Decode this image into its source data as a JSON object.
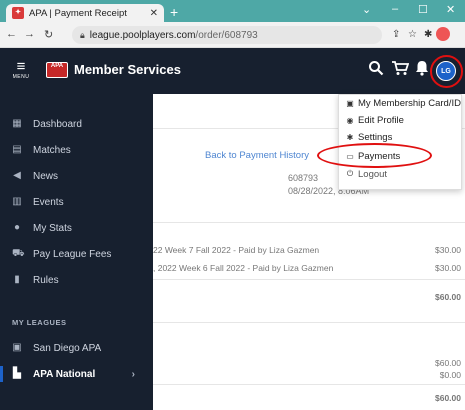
{
  "browser": {
    "tab_title": "APA | Payment Receipt",
    "tab_close": "✕",
    "new_tab": "+",
    "url_host": "league.poolplayers.com",
    "url_path": "/order/608793",
    "window_controls": [
      "⌄",
      "–",
      "☐",
      "✕"
    ]
  },
  "header": {
    "menu_label": "MENU",
    "logo_text": "APA",
    "title": "Member Services",
    "avatar_initials": "LG"
  },
  "sidebar": {
    "items": [
      {
        "label": "Dashboard",
        "icon": "dashboard-icon"
      },
      {
        "label": "Matches",
        "icon": "matches-icon"
      },
      {
        "label": "News",
        "icon": "megaphone-icon"
      },
      {
        "label": "Events",
        "icon": "calendar-icon"
      },
      {
        "label": "My Stats",
        "icon": "person-icon"
      },
      {
        "label": "Pay League Fees",
        "icon": "cart-icon"
      },
      {
        "label": "Rules",
        "icon": "book-icon"
      }
    ],
    "section_label": "MY LEAGUES",
    "leagues": [
      {
        "label": "San Diego APA",
        "icon": "id-card-icon"
      },
      {
        "label": "APA National",
        "icon": "building-icon",
        "chevron": "›"
      }
    ]
  },
  "main": {
    "back_link": "Back to Payment History",
    "order_number": "608793",
    "order_date": "08/28/2022, 8:06AM",
    "line_items": [
      {
        "desc": "22 Week 7 Fall 2022 - Paid by Liza Gazmen",
        "amount": "$30.00"
      },
      {
        "desc": ", 2022 Week 6 Fall 2022 - Paid by Liza Gazmen",
        "amount": "$30.00"
      }
    ],
    "subtotal": "$60.00",
    "summary": {
      "total": "$60.00",
      "discount": "$0.00",
      "grand_total": "$60.00"
    }
  },
  "dropdown": {
    "items": [
      {
        "label": "My Membership Card/ID",
        "icon": "id-card-icon"
      },
      {
        "label": "Edit Profile",
        "icon": "user-circle-icon"
      },
      {
        "label": "Settings",
        "icon": "gear-icon"
      },
      {
        "label": "Payments",
        "icon": "credit-card-icon"
      },
      {
        "label": "Logout",
        "icon": "logout-icon"
      }
    ]
  },
  "colors": {
    "nav_bg": "#17202f",
    "accent_blue": "#1d62c9",
    "link_blue": "#4f86d1",
    "annotation_red": "#e01010",
    "tab_bar": "#4ea8a6"
  }
}
